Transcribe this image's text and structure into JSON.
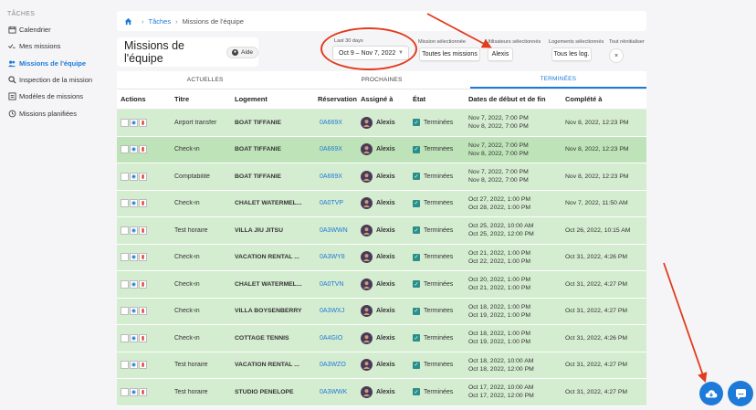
{
  "sidebar": {
    "section": "TÂCHES",
    "items": [
      {
        "label": "Calendrier",
        "icon": "calendar-icon"
      },
      {
        "label": "Mes missions",
        "icon": "checklist-icon"
      },
      {
        "label": "Missions de l'équipe",
        "icon": "team-icon",
        "active": true
      },
      {
        "label": "Inspection de la mission",
        "icon": "search-icon"
      },
      {
        "label": "Modèles de missions",
        "icon": "template-icon"
      },
      {
        "label": "Missions planifiées",
        "icon": "clock-icon"
      }
    ]
  },
  "breadcrumb": {
    "home_icon": "home-icon",
    "link": "Tâches",
    "current": "Missions de l'équipe"
  },
  "page": {
    "title": "Missions de l'équipe",
    "help": "Aide"
  },
  "filters": {
    "date_label": "Last 30 days",
    "date_value": "Oct 9 – Nov 7, 2022",
    "mission_label": "Mission sélectionnée",
    "mission_value": "Toutes les missions",
    "users_label": "Utilisateurs sélectionnés",
    "users_value": "Alexis",
    "logements_label": "Logements sélectionnés",
    "logements_value": "Tous les log.",
    "reset_label": "Tout réinitialiser",
    "reset_icon": "×"
  },
  "tabs": [
    "ACTUELLES",
    "PROCHAINES",
    "TERMINÉES"
  ],
  "active_tab": 2,
  "table": {
    "headers": [
      "Actions",
      "Titre",
      "Logement",
      "Réservation",
      "Assigné à",
      "État",
      "Dates de début et de fin",
      "Complété à"
    ],
    "rows": [
      {
        "titre": "Airport transfer",
        "logement": "BOAT TIFFANIE",
        "res": "0A669X",
        "assigne": "Alexis",
        "etat": "Terminées",
        "start": "Nov 7, 2022, 7:00 PM",
        "end": "Nov 8, 2022, 7:00 PM",
        "complete": "Nov 8, 2022, 12:23 PM"
      },
      {
        "titre": "Check-in",
        "logement": "BOAT TIFFANIE",
        "res": "0A669X",
        "assigne": "Alexis",
        "etat": "Terminées",
        "start": "Nov 7, 2022, 7:00 PM",
        "end": "Nov 8, 2022, 7:00 PM",
        "complete": "Nov 8, 2022, 12:23 PM",
        "highlight": true
      },
      {
        "titre": "Comptabilité",
        "logement": "BOAT TIFFANIE",
        "res": "0A669X",
        "assigne": "Alexis",
        "etat": "Terminées",
        "start": "Nov 7, 2022, 7:00 PM",
        "end": "Nov 8, 2022, 7:00 PM",
        "complete": "Nov 8, 2022, 12:23 PM"
      },
      {
        "titre": "Check-in",
        "logement": "CHALET WATERMEL...",
        "res": "0A0TVP",
        "assigne": "Alexis",
        "etat": "Terminées",
        "start": "Oct 27, 2022, 1:00 PM",
        "end": "Oct 28, 2022, 1:00 PM",
        "complete": "Nov 7, 2022, 11:50 AM"
      },
      {
        "titre": "Test horaire",
        "logement": "VILLA JIU JITSU",
        "res": "0A3WWN",
        "assigne": "Alexis",
        "etat": "Terminées",
        "start": "Oct 25, 2022, 10:00 AM",
        "end": "Oct 25, 2022, 12:00 PM",
        "complete": "Oct 26, 2022, 10:15 AM"
      },
      {
        "titre": "Check-in",
        "logement": "VACATION RENTAL ...",
        "res": "0A3WY8",
        "assigne": "Alexis",
        "etat": "Terminées",
        "start": "Oct 21, 2022, 1:00 PM",
        "end": "Oct 22, 2022, 1:00 PM",
        "complete": "Oct 31, 2022, 4:26 PM"
      },
      {
        "titre": "Check-in",
        "logement": "CHALET WATERMEL...",
        "res": "0A0TVN",
        "assigne": "Alexis",
        "etat": "Terminées",
        "start": "Oct 20, 2022, 1:00 PM",
        "end": "Oct 21, 2022, 1:00 PM",
        "complete": "Oct 31, 2022, 4:27 PM"
      },
      {
        "titre": "Check-in",
        "logement": "VILLA BOYSENBERRY",
        "res": "0A3WXJ",
        "assigne": "Alexis",
        "etat": "Terminées",
        "start": "Oct 18, 2022, 1:00 PM",
        "end": "Oct 19, 2022, 1:00 PM",
        "complete": "Oct 31, 2022, 4:27 PM"
      },
      {
        "titre": "Check-in",
        "logement": "COTTAGE TENNIS",
        "res": "0A4GIO",
        "assigne": "Alexis",
        "etat": "Terminées",
        "start": "Oct 18, 2022, 1:00 PM",
        "end": "Oct 19, 2022, 1:00 PM",
        "complete": "Oct 31, 2022, 4:26 PM"
      },
      {
        "titre": "Test horaire",
        "logement": "VACATION RENTAL ...",
        "res": "0A3WZO",
        "assigne": "Alexis",
        "etat": "Terminées",
        "start": "Oct 18, 2022, 10:00 AM",
        "end": "Oct 18, 2022, 12:00 PM",
        "complete": "Oct 31, 2022, 4:27 PM"
      },
      {
        "titre": "Test horaire",
        "logement": "STUDIO PENELOPE",
        "res": "0A3WWK",
        "assigne": "Alexis",
        "etat": "Terminées",
        "start": "Oct 17, 2022, 10:00 AM",
        "end": "Oct 17, 2022, 12:00 PM",
        "complete": "Oct 31, 2022, 4:27 PM"
      }
    ]
  },
  "colors": {
    "accent": "#1e7ad8",
    "row_done": "#d4ecd0",
    "annotation": "#e23b1e"
  }
}
